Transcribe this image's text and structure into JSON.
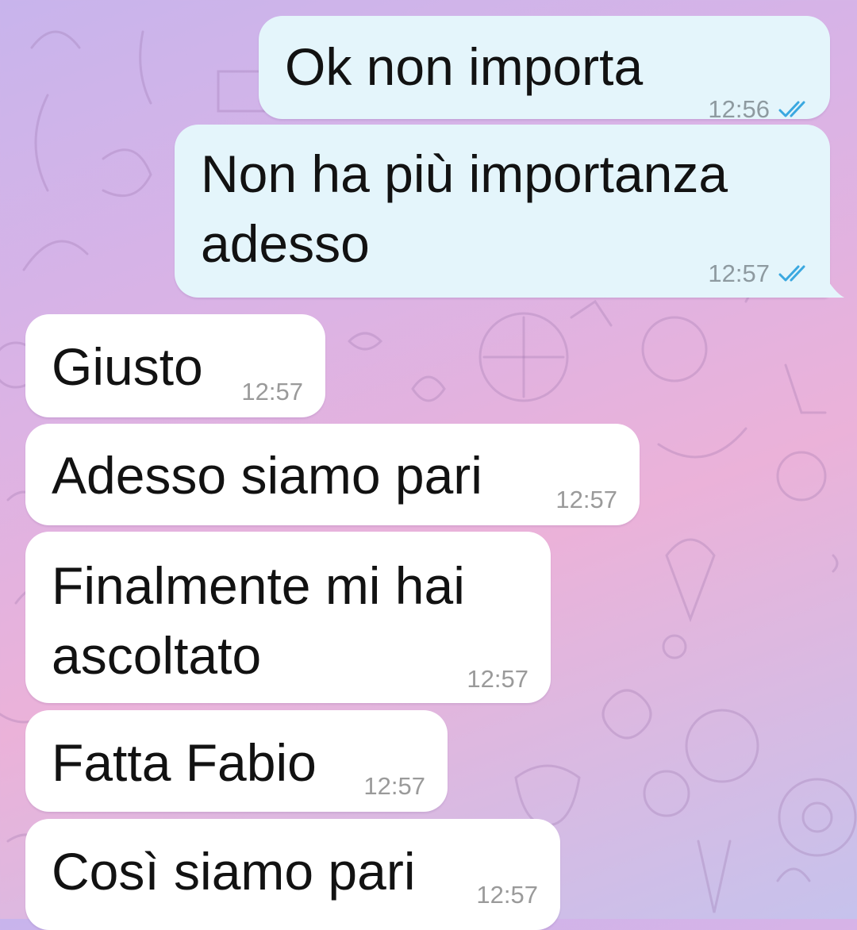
{
  "messages": [
    {
      "direction": "out",
      "text": "Ok non importa",
      "time": "12:56",
      "status": "read-double-check-icon"
    },
    {
      "direction": "out",
      "text": "Non ha più importanza\nadesso",
      "time": "12:57",
      "status": "read-double-check-icon"
    },
    {
      "direction": "in",
      "text": "Giusto",
      "time": "12:57"
    },
    {
      "direction": "in",
      "text": "Adesso siamo pari",
      "time": "12:57"
    },
    {
      "direction": "in",
      "text": "Finalmente mi hai\nascoltato",
      "time": "12:57"
    },
    {
      "direction": "in",
      "text": "Fatta Fabio",
      "time": "12:57"
    },
    {
      "direction": "in",
      "text": "Così siamo pari",
      "time": "12:57"
    }
  ],
  "colors": {
    "outgoing_bubble": "#e4f5fb",
    "incoming_bubble": "#ffffff",
    "read_check": "#3aa8e0"
  }
}
